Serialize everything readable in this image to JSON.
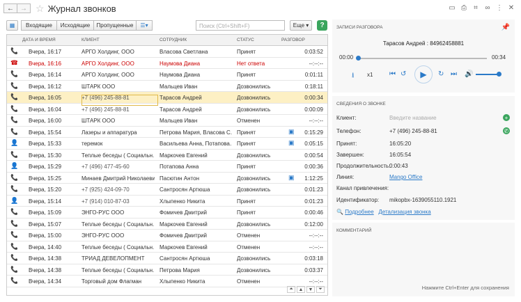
{
  "window": {
    "title": "Журнал звонков"
  },
  "toolbar": {
    "incoming": "Входящие",
    "outgoing": "Исходящие",
    "missed": "Пропущенные",
    "search_placeholder": "Поиск (Ctrl+Shift+F)",
    "more": "Еще",
    "help": "?"
  },
  "grid": {
    "headers": {
      "date": "ДАТА И ВРЕМЯ",
      "client": "КЛИЕНТ",
      "employee": "СОТРУДНИК",
      "status": "СТАТУС",
      "duration": "РАЗГОВОР"
    },
    "rows": [
      {
        "icon": "📞",
        "date": "Вчера, 16:17",
        "client": "АРГО Холдинг, ООО",
        "employee": "Власова Светлана",
        "status": "Принят",
        "rec": "",
        "dur": "0:03:52"
      },
      {
        "icon": "☎",
        "date": "Вчера, 16:16",
        "client": "АРГО Холдинг, ООО",
        "employee": "Наумова Диана",
        "status": "Нет ответа",
        "rec": "",
        "dur": "--:--:--"
      },
      {
        "icon": "📞",
        "date": "Вчера, 16:14",
        "client": "АРГО Холдинг, ООО",
        "employee": "Наумова Диана",
        "status": "Принят",
        "rec": "",
        "dur": "0:01:11"
      },
      {
        "icon": "📞",
        "date": "Вчера, 16:12",
        "client": "ШТАРК ООО",
        "employee": "Мальцев Иван",
        "status": "Дозвонились",
        "rec": "",
        "dur": "0:18:11"
      },
      {
        "icon": "📞",
        "date": "Вчера, 16:05",
        "client": "+7 (496) 245-88-81",
        "employee": "Тарасов Андрей",
        "status": "Дозвонились",
        "rec": "",
        "dur": "0:00:34"
      },
      {
        "icon": "📞",
        "date": "Вчера, 16:04",
        "client": "+7 (496) 245-88-81",
        "employee": "Тарасов Андрей",
        "status": "Дозвонились",
        "rec": "",
        "dur": "0:00:09"
      },
      {
        "icon": "📞",
        "date": "Вчера, 16:00",
        "client": "ШТАРК ООО",
        "employee": "Мальцев Иван",
        "status": "Отменен",
        "rec": "",
        "dur": "--:--:--"
      },
      {
        "icon": "📞",
        "date": "Вчера, 15:54",
        "client": "Лазеры и аппаратура",
        "employee": "Петрова Мария, Власова С...",
        "status": "Принят",
        "rec": "▣",
        "dur": "0:15:29"
      },
      {
        "icon": "👤",
        "date": "Вчера, 15:33",
        "client": "теремок",
        "employee": "Васильева Анна, Потапова...",
        "status": "Принят",
        "rec": "▣",
        "dur": "0:05:15"
      },
      {
        "icon": "📞",
        "date": "Вчера, 15:30",
        "client": "Теплые беседы ( Социальн...",
        "employee": "Маркочев Евгений",
        "status": "Дозвонились",
        "rec": "",
        "dur": "0:00:54"
      },
      {
        "icon": "👤",
        "date": "Вчера, 15:29",
        "client": "+7 (496) 477-45-60",
        "employee": "Потапова Анна",
        "status": "Принят",
        "rec": "",
        "dur": "0:00:36"
      },
      {
        "icon": "📞",
        "date": "Вчера, 15:25",
        "client": "Минаев Дмитрий Николаевич",
        "employee": "Пасютин Антон",
        "status": "Дозвонились",
        "rec": "▣",
        "dur": "1:12:25"
      },
      {
        "icon": "📞",
        "date": "Вчера, 15:20",
        "client": "+7 (925) 424-09-70",
        "employee": "Сантросян Артюша",
        "status": "Дозвонились",
        "rec": "",
        "dur": "0:01:23"
      },
      {
        "icon": "👤",
        "date": "Вчера, 15:14",
        "client": "+7 (914) 010-87-03",
        "employee": "Хлыпенко Никита",
        "status": "Принят",
        "rec": "",
        "dur": "0:01:23"
      },
      {
        "icon": "📞",
        "date": "Вчера, 15:09",
        "client": "ЭНГО-РУС ООО",
        "employee": "Фомичев Дмитрий",
        "status": "Принят",
        "rec": "",
        "dur": "0:00:46"
      },
      {
        "icon": "📞",
        "date": "Вчера, 15:07",
        "client": "Теплые беседы ( Социальн...",
        "employee": "Маркочев Евгений",
        "status": "Дозвонились",
        "rec": "",
        "dur": "0:12:00"
      },
      {
        "icon": "📞",
        "date": "Вчера, 15:00",
        "client": "ЭНГО-РУС ООО",
        "employee": "Фомичев Дмитрий",
        "status": "Отменен",
        "rec": "",
        "dur": "--:--:--"
      },
      {
        "icon": "📞",
        "date": "Вчера, 14:40",
        "client": "Теплые беседы ( Социальн...",
        "employee": "Маркочев Евгений",
        "status": "Отменен",
        "rec": "",
        "dur": "--:--:--"
      },
      {
        "icon": "📞",
        "date": "Вчера, 14:38",
        "client": "ТРИАД ДЕВЕЛОПМЕНТ",
        "employee": "Сантросян Артюша",
        "status": "Дозвонились",
        "rec": "",
        "dur": "0:03:18"
      },
      {
        "icon": "📞",
        "date": "Вчера, 14:38",
        "client": "Теплые беседы ( Социальн...",
        "employee": "Петрова Мария",
        "status": "Дозвонились",
        "rec": "",
        "dur": "0:03:37"
      },
      {
        "icon": "📞",
        "date": "Вчера, 14:34",
        "client": "Торговый дом Флагман",
        "employee": "Хлыпенко Никита",
        "status": "Отменен",
        "rec": "",
        "dur": "--:--:--"
      }
    ]
  },
  "recording": {
    "title": "ЗАПИСИ РАЗГОВОРА",
    "caller": "Тарасов Андрей : 84962458881",
    "start": "00:00",
    "end": "00:34",
    "speed": "x1"
  },
  "details": {
    "title": "СВЕДЕНИЯ О ЗВОНКЕ",
    "client_label": "Клиент:",
    "client_placeholder": "Введите название",
    "phone_label": "Телефон:",
    "phone": "+7 (496) 245-88-81",
    "accepted_label": "Принят:",
    "accepted": "16:05:20",
    "ended_label": "Завершен:",
    "ended": "16:05:54",
    "duration_label": "Продолжительность:",
    "duration": "0:00:43",
    "line_label": "Линия:",
    "line": "Mango Office",
    "channel_label": "Канал привлечения:",
    "id_label": "Идентификатор:",
    "id": "mikopbx-1639055110.1921",
    "more_link": "Подробнее",
    "detail_link": "Детализация звонка"
  },
  "comments": {
    "title": "КОММЕНТАРИЙ",
    "hint": "Нажмите Ctrl+Enter для сохранения"
  },
  "colors": {
    "accent": "#2b7ac8",
    "green": "#3aa55d",
    "selected": "#fdf0c4",
    "missed": "#cc0000"
  }
}
